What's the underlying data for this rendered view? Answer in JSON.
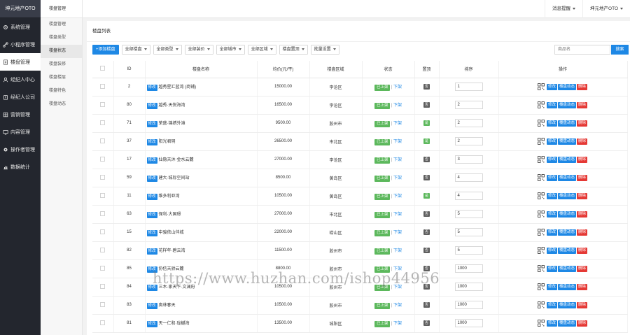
{
  "sidebar": {
    "brand": "坤元地产OTO",
    "items": [
      {
        "label": "系统管理",
        "icon": "gear-icon"
      },
      {
        "label": "小程序管理",
        "icon": "link-icon"
      },
      {
        "label": "楼盘管理",
        "icon": "document-icon"
      },
      {
        "label": "经纪人中心",
        "icon": "user-icon"
      },
      {
        "label": "经纪人公司",
        "icon": "building-icon"
      },
      {
        "label": "营销管理",
        "icon": "grid-icon"
      },
      {
        "label": "内容管理",
        "icon": "monitor-icon"
      },
      {
        "label": "操作者管理",
        "icon": "cog-icon"
      },
      {
        "label": "数据统计",
        "icon": "chart-icon"
      }
    ]
  },
  "submenu": {
    "title": "楼盘管理",
    "items": [
      "楼盘管理",
      "楼盘类型",
      "楼盘状态",
      "楼盘装修",
      "楼盘楼层",
      "楼盘特色",
      "楼盘动态"
    ]
  },
  "topbar": {
    "title": "楼盘管理",
    "notice": "消息提醒",
    "user": "坤元地产OTO"
  },
  "panel": {
    "title": "楼盘列表"
  },
  "toolbar": {
    "add_label": "+添加楼盘",
    "filters": [
      "全部楼盘",
      "全部类型",
      "全部装价",
      "全部城市",
      "全部区域",
      "楼盘置顶",
      "批量设置"
    ],
    "search_placeholder": "商品名",
    "search_label": "搜索"
  },
  "table": {
    "headers": [
      "",
      "ID",
      "楼盘名称",
      "均价(元/平)",
      "楼盘区域",
      "状态",
      "置顶",
      "排序",
      "操作"
    ],
    "edit_tag": "修改",
    "status_on": "已上架",
    "status_off": "下架",
    "ops": {
      "edit": "修改",
      "news": "楼盘动态",
      "del": "删除"
    },
    "rows": [
      {
        "id": "2",
        "name": "越秀星汇蓝湾 (商铺)",
        "price": "15000.00",
        "area": "李沧区",
        "top": false,
        "sort": "1"
      },
      {
        "id": "80",
        "name": "越秀·天悦海湾",
        "price": "16500.00",
        "area": "李沧区",
        "top": false,
        "sort": "2"
      },
      {
        "id": "71",
        "name": "荣盛·锦绣外滩",
        "price": "9500.00",
        "area": "胶州市",
        "top": true,
        "sort": "2"
      },
      {
        "id": "37",
        "name": "阳光君玥",
        "price": "26500.00",
        "area": "市北区",
        "top": true,
        "sort": "2"
      },
      {
        "id": "17",
        "name": "仙隐天沐·金水云麓",
        "price": "27000.00",
        "area": "李沧区",
        "top": false,
        "sort": "3"
      },
      {
        "id": "59",
        "name": "建大·城际空间站",
        "price": "8500.00",
        "area": "黄岛区",
        "top": false,
        "sort": "4"
      },
      {
        "id": "11",
        "name": "维多利亚湾",
        "price": "10500.00",
        "area": "黄岛区",
        "top": true,
        "sort": "4"
      },
      {
        "id": "63",
        "name": "保利·大国璟",
        "price": "27000.00",
        "area": "市北区",
        "top": false,
        "sort": "5"
      },
      {
        "id": "15",
        "name": "中骏依山伴城",
        "price": "22000.00",
        "area": "崂山区",
        "top": false,
        "sort": "5"
      },
      {
        "id": "82",
        "name": "花样年·碧云湾",
        "price": "11500.00",
        "area": "胶州市",
        "top": false,
        "sort": "5"
      },
      {
        "id": "85",
        "name": "协信天骄云麓",
        "price": "8800.00",
        "area": "胶州市",
        "top": false,
        "sort": "1000"
      },
      {
        "id": "84",
        "name": "三木·家天下·文澜府",
        "price": "10500.00",
        "area": "胶州市",
        "top": false,
        "sort": "1000"
      },
      {
        "id": "83",
        "name": "奥林春天",
        "price": "10500.00",
        "area": "胶州市",
        "top": false,
        "sort": "1000"
      },
      {
        "id": "81",
        "name": "天一仁和·珑樾海",
        "price": "13500.00",
        "area": "城阳区",
        "top": false,
        "sort": "1000"
      }
    ]
  },
  "watermark": "https://www.huzhan.com/ishop44956",
  "colors": {
    "primary": "#1e88e5",
    "success": "#5cb85c",
    "danger": "#e53935",
    "sidebar": "#23262e"
  }
}
